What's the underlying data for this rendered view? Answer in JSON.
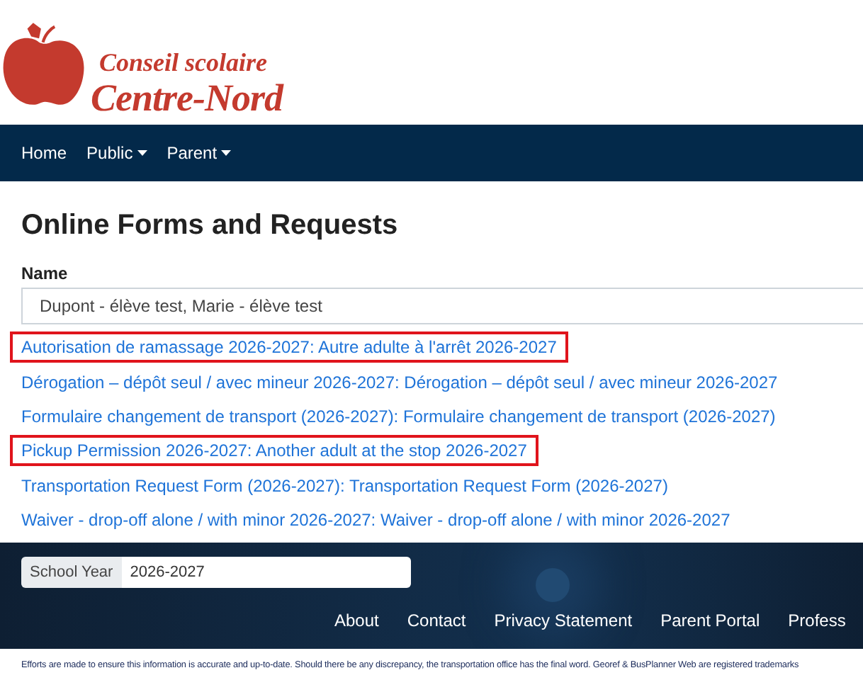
{
  "logo": {
    "line_1": "Conseil scolaire",
    "line_2": "Centre-Nord"
  },
  "nav": [
    {
      "label": "Home",
      "dropdown": false
    },
    {
      "label": "Public",
      "dropdown": true
    },
    {
      "label": "Parent",
      "dropdown": true
    }
  ],
  "page_title": "Online Forms and Requests",
  "name_field": {
    "label": "Name",
    "value": "Dupont - élève test, Marie - élève test"
  },
  "forms": [
    {
      "label": "Autorisation de ramassage 2026-2027: Autre adulte à l'arrêt 2026-2027",
      "highlighted": true
    },
    {
      "label": "Dérogation – dépôt seul / avec mineur 2026-2027: Dérogation – dépôt seul / avec mineur 2026-2027",
      "highlighted": false
    },
    {
      "label": "Formulaire changement de transport (2026-2027): Formulaire changement de transport (2026-2027)",
      "highlighted": false
    },
    {
      "label": "Pickup Permission 2026-2027: Another adult at the stop 2026-2027",
      "highlighted": true
    },
    {
      "label": "Transportation Request Form (2026-2027): Transportation Request Form (2026-2027)",
      "highlighted": false
    },
    {
      "label": "Waiver - drop-off alone / with minor 2026-2027: Waiver - drop-off alone / with minor 2026-2027",
      "highlighted": false
    }
  ],
  "school_year": {
    "label": "School Year",
    "value": "2026-2027"
  },
  "footer_links": [
    "About",
    "Contact",
    "Privacy Statement",
    "Parent Portal",
    "Profess"
  ],
  "disclaimer": "Efforts are made to ensure this information is accurate and up-to-date. Should there be any discrepancy, the transportation office has the final word. Georef & BusPlanner Web are registered trademarks"
}
